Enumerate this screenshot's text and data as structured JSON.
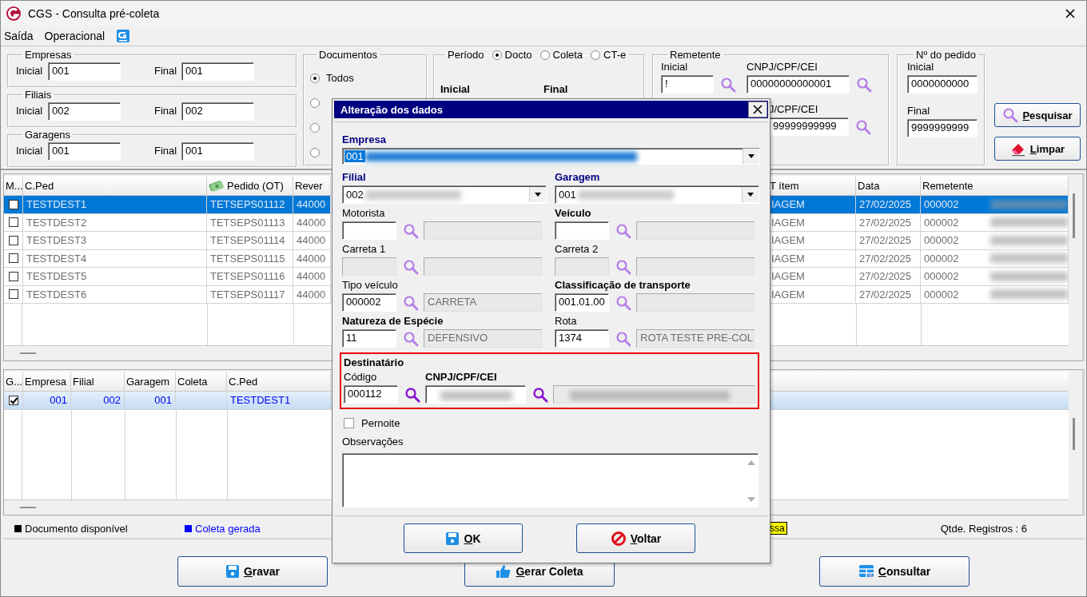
{
  "window": {
    "title": "CGS - Consulta pré-coleta"
  },
  "menu": [
    {
      "label": "Saída"
    },
    {
      "label": "Operacional"
    }
  ],
  "filters": {
    "ranges": [
      {
        "legend": "Empresas",
        "initial_label": "Inicial",
        "initial": "001",
        "final_label": "Final",
        "final": "001"
      },
      {
        "legend": "Filiais",
        "initial_label": "Inicial",
        "initial": "002",
        "final_label": "Final",
        "final": "002"
      },
      {
        "legend": "Garagens",
        "initial_label": "Inicial",
        "initial": "001",
        "final_label": "Final",
        "final": "001"
      }
    ],
    "documentos": {
      "legend": "Documentos",
      "options": [
        {
          "label": "Todos",
          "selected": true
        },
        {
          "selected": false
        },
        {
          "selected": false
        },
        {
          "selected": false
        }
      ]
    },
    "periodo": {
      "legend": "Período",
      "options": [
        {
          "label": "Docto",
          "selected": true
        },
        {
          "label": "Coleta",
          "selected": false
        },
        {
          "label": "CT-e",
          "selected": false
        }
      ],
      "initial_label": "Inicial",
      "final_label": "Final"
    },
    "remetente": {
      "legend": "Remetente",
      "initial_label": "Inicial",
      "initial": "!",
      "cnpj_label": "CNPJ/CPF/CEI",
      "cnpj": "00000000000001",
      "cnpj_final_label": "J/CPF/CEI",
      "cnpj_final": "99999999999"
    },
    "pedido": {
      "legend": "Nº do pedido",
      "initial_label": "Inicial",
      "initial": "0000000000",
      "final_label": "Final",
      "final": "9999999999"
    },
    "buttons": [
      {
        "label": "Pesquisar",
        "kind": "search"
      },
      {
        "label": "Limpar",
        "kind": "clear"
      }
    ]
  },
  "orders": {
    "columns": [
      {
        "label": "M..."
      },
      {
        "label": "C.Ped"
      },
      {
        "label": "Pedido (OT)",
        "kind": "money"
      },
      {
        "label": "Rever"
      },
      {
        "label": "T ítem"
      },
      {
        "label": "Data"
      },
      {
        "label": "Remetente",
        "blurred": true
      }
    ],
    "rows": [
      {
        "checked": false,
        "selected": true,
        "cells": [
          "",
          "TESTDEST1",
          "TETSEPS01112",
          "44000",
          "IAGEM",
          "27/02/2025",
          "000002"
        ]
      },
      {
        "checked": false,
        "selected": false,
        "cells": [
          "",
          "TESTDEST2",
          "TETSEPS01113",
          "44000",
          "IAGEM",
          "27/02/2025",
          "000002"
        ]
      },
      {
        "checked": false,
        "selected": false,
        "cells": [
          "",
          "TESTDEST3",
          "TETSEPS01114",
          "44000",
          "IAGEM",
          "27/02/2025",
          "000002"
        ]
      },
      {
        "checked": false,
        "selected": false,
        "cells": [
          "",
          "TESTDEST4",
          "TETSEPS01115",
          "44000",
          "IAGEM",
          "27/02/2025",
          "000002"
        ]
      },
      {
        "checked": false,
        "selected": false,
        "cells": [
          "",
          "TESTDEST5",
          "TETSEPS01116",
          "44000",
          "IAGEM",
          "27/02/2025",
          "000002"
        ]
      },
      {
        "checked": false,
        "selected": false,
        "cells": [
          "",
          "TESTDEST6",
          "TETSEPS01117",
          "44000",
          "IAGEM",
          "27/02/2025",
          "000002"
        ]
      }
    ]
  },
  "generated": {
    "columns": [
      {
        "label": "G..."
      },
      {
        "label": "Empresa"
      },
      {
        "label": "Filial"
      },
      {
        "label": "Garagem"
      },
      {
        "label": "Coleta"
      },
      {
        "label": "C.Ped"
      }
    ],
    "rows": [
      {
        "checked": true,
        "selected": true,
        "cells": [
          "",
          "001",
          "002",
          "001",
          "",
          "TESTDEST1"
        ]
      }
    ]
  },
  "legend": {
    "items": [
      {
        "label": "Documento disponível",
        "color": "#000000"
      },
      {
        "label": "Coleta gerada",
        "color": "#0000ff"
      }
    ],
    "badge": "ssa",
    "count": "Qtde. Registros : 6"
  },
  "actions": [
    {
      "label": "Gravar",
      "kind": "save"
    },
    {
      "label": "Gerar Coleta",
      "kind": "thumb"
    },
    {
      "label": "Consultar",
      "kind": "grid"
    }
  ],
  "dialog": {
    "title": "Alteração dos dados",
    "empresa": {
      "label": "Empresa",
      "value": "001",
      "highlighted": true
    },
    "filial": {
      "label": "Filial",
      "value": "002"
    },
    "garagem": {
      "label": "Garagem",
      "value": "001"
    },
    "lookups": [
      {
        "label": "Motorista",
        "bold": false,
        "code_disabled": false
      },
      {
        "label": "Veículo",
        "bold": true,
        "code_disabled": false
      },
      {
        "label": "Carreta 1",
        "bold": false,
        "code_disabled": true
      },
      {
        "label": "Carreta 2",
        "bold": false,
        "code_disabled": true
      },
      {
        "label": "Tipo veículo",
        "bold": false,
        "code": "000002",
        "description": "CARRETA",
        "code_disabled": false
      },
      {
        "label": "Classificação de transporte",
        "bold": true,
        "code": "001.01.00",
        "code_disabled": false
      },
      {
        "label": "Natureza de Espécie",
        "bold": true,
        "code": "11",
        "description": "DEFENSIVO",
        "code_disabled": false
      },
      {
        "label": "Rota",
        "bold": false,
        "code": "1374",
        "description": "ROTA TESTE PRE-COL",
        "code_disabled": false
      }
    ],
    "destinatario": {
      "title": "Destinatário",
      "code_label": "Código",
      "code": "000112",
      "cnpj_label": "CNPJ/CPF/CEI"
    },
    "pernoite": {
      "label": "Pernoite",
      "checked": false
    },
    "observacoes": {
      "label": "Observações"
    },
    "buttons": [
      {
        "label": "OK",
        "kind": "save"
      },
      {
        "label": "Voltar",
        "kind": "cancel"
      }
    ]
  }
}
